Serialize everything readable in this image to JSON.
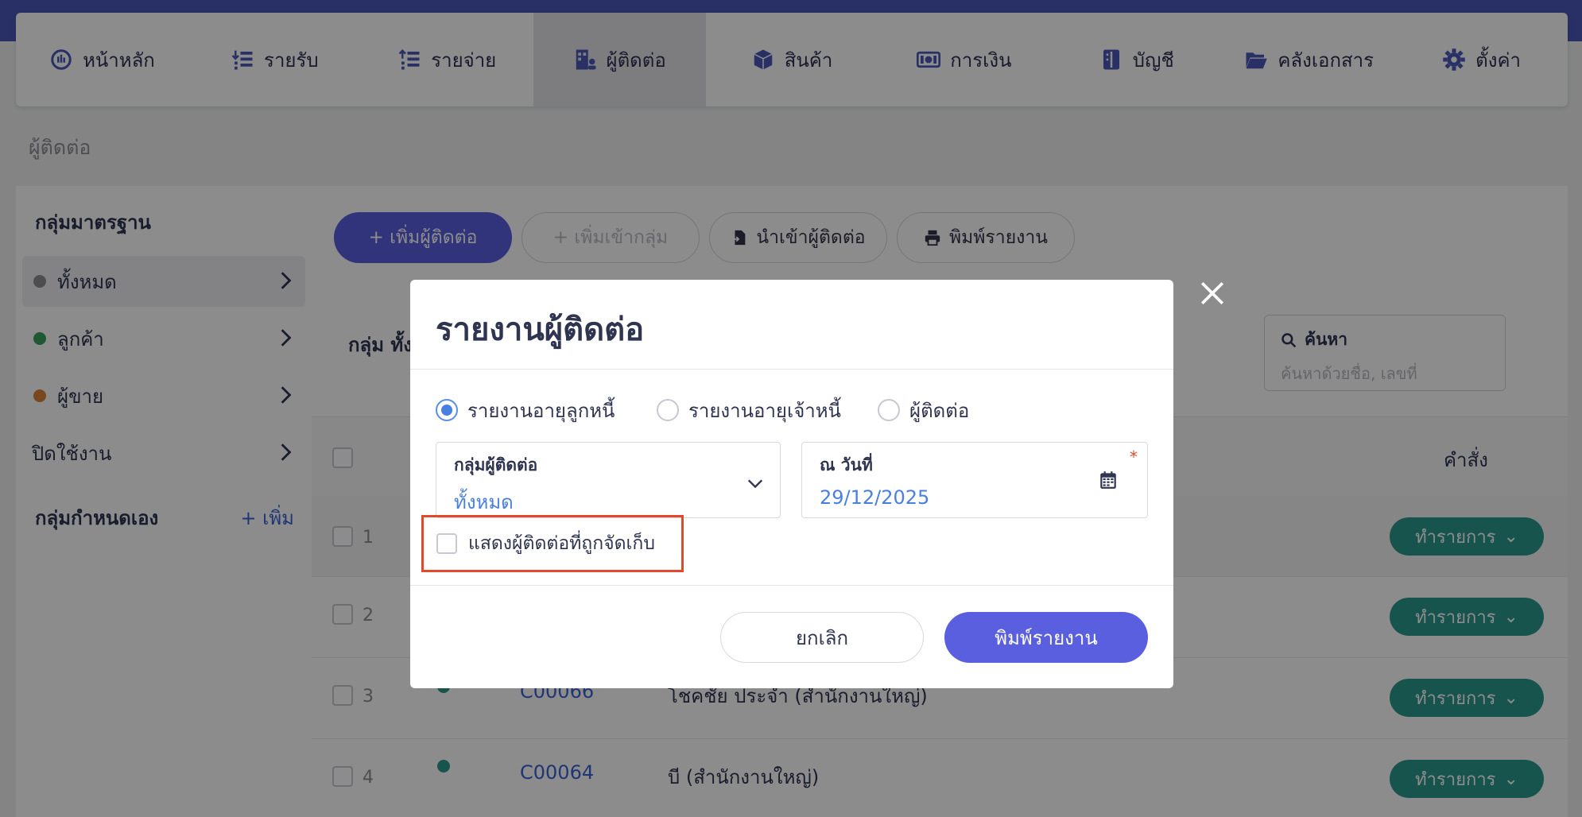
{
  "nav": {
    "items": [
      {
        "label": "หน้าหลัก",
        "icon": "dashboard-gauge-icon"
      },
      {
        "label": "รายรับ",
        "icon": "income-list-icon"
      },
      {
        "label": "รายจ่าย",
        "icon": "expense-list-icon"
      },
      {
        "label": "ผู้ติดต่อ",
        "icon": "contacts-building-icon",
        "active": true
      },
      {
        "label": "สินค้า",
        "icon": "product-box-icon"
      },
      {
        "label": "การเงิน",
        "icon": "money-bill-icon"
      },
      {
        "label": "บัญชี",
        "icon": "ledger-book-icon"
      },
      {
        "label": "คลังเอกสาร",
        "icon": "folder-open-icon"
      },
      {
        "label": "ตั้งค่า",
        "icon": "gear-icon"
      }
    ]
  },
  "page": {
    "title": "ผู้ติดต่อ"
  },
  "sidebar": {
    "standard_groups_heading": "กลุ่มมาตรฐาน",
    "items": [
      {
        "label": "ทั้งหมด",
        "color": "#8d8d8d"
      },
      {
        "label": "ลูกค้า",
        "color": "#3aa05c"
      },
      {
        "label": "ผู้ขาย",
        "color": "#d9823a"
      },
      {
        "label": "ปิดใช้งาน"
      }
    ],
    "custom_groups_heading": "กลุ่มกำหนดเอง",
    "add_label": "+ เพิ่ม"
  },
  "toolbar": {
    "add_contact": "+ เพิ่มผู้ติดต่อ",
    "add_to_group": "+ เพิ่มเข้ากลุ่ม",
    "import_contacts": "นำเข้าผู้ติดต่อ",
    "print_report": "พิมพ์รายงาน"
  },
  "list": {
    "group_label": "กลุ่ม ทั้ง",
    "search_title": "ค้นหา",
    "search_placeholder": "ค้นหาด้วยชื่อ, เลขที่",
    "command_header": "คำสั่ง",
    "action_label": "ทำรายการ",
    "rows": [
      {
        "num": "1",
        "code": "",
        "name": ""
      },
      {
        "num": "2",
        "code": "",
        "name": ""
      },
      {
        "num": "3",
        "code": "C00066",
        "name": "โชคชัย ประจำ (สำนักงานใหญ่)"
      },
      {
        "num": "4",
        "code": "C00064",
        "name": "บี (สำนักงานใหญ่)"
      }
    ]
  },
  "modal": {
    "title": "รายงานผู้ติดต่อ",
    "radio_options": [
      {
        "label": "รายงานอายุลูกหนี้",
        "checked": true
      },
      {
        "label": "รายงานอายุเจ้าหนี้",
        "checked": false
      },
      {
        "label": "ผู้ติดต่อ",
        "checked": false
      }
    ],
    "group_field": {
      "label": "กลุ่มผู้ติดต่อ",
      "value": "ทั้งหมด"
    },
    "date_field": {
      "label": "ณ วันที่",
      "value": "29/12/2025",
      "required_mark": "*"
    },
    "show_archived_label": "แสดงผู้ติดต่อที่ถูกจัดเก็บ",
    "cancel_label": "ยกเลิก",
    "print_label": "พิมพ์รายงาน"
  },
  "colors": {
    "topbar": "#4b58b8",
    "primary": "#5a5fe0",
    "action_teal": "#2b9a8c",
    "link_blue": "#3a63d6",
    "highlight_red": "#e04a2a"
  }
}
